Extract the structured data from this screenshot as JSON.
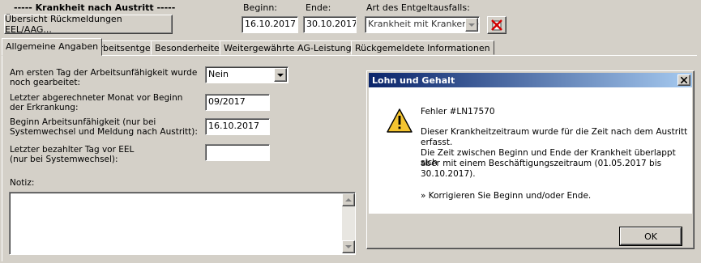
{
  "header": {
    "section_title": "----- Krankheit nach Austritt -----",
    "overview_button": "Übersicht Rückmeldungen EEL/AAG...",
    "begin_label": "Beginn:",
    "begin_value": "16.10.2017",
    "end_label": "Ende:",
    "end_value": "30.10.2017",
    "type_label": "Art des Entgeltausfalls:",
    "type_value": "Krankheit mit Krankengeld"
  },
  "tabs": [
    {
      "label": "Allgemeine Angaben",
      "active": true
    },
    {
      "label": "Arbeitsentgelt"
    },
    {
      "label": "Besonderheiten"
    },
    {
      "label": "Weitergewährte AG-Leistungen"
    },
    {
      "label": "Rückgemeldete Informationen"
    }
  ],
  "form": {
    "worked_label_1": "Am ersten Tag der Arbeitsunfähigkeit wurde",
    "worked_label_2": "noch gearbeitet:",
    "worked_value": "Nein",
    "last_month_label_1": "Letzter abgerechneter Monat vor Beginn",
    "last_month_label_2": "der Erkrankung:",
    "last_month_value": "09/2017",
    "begin_au_label_1": "Beginn Arbeitsunfähigkeit (nur bei",
    "begin_au_label_2": "Systemwechsel und Meldung nach Austritt):",
    "begin_au_value": "16.10.2017",
    "last_paid_label_1": "Letzter bezahlter Tag vor EEL",
    "last_paid_label_2": "(nur bei Systemwechsel):",
    "last_paid_value": "",
    "note_label": "Notiz:",
    "note_value": ""
  },
  "dialog": {
    "title": "Lohn und Gehalt",
    "error_code": "Fehler #LN17570",
    "line1": "Dieser Krankheitzeitraum wurde für die Zeit nach dem Austritt",
    "line2": "erfasst.",
    "line3": "Die Zeit zwischen Beginn und Ende der Krankheit überlappt sich",
    "line4": "aber mit einem Beschäftigungszeitraum (01.05.2017 bis",
    "line5": "30.10.2017).",
    "line6": "» Korrigieren Sie Beginn und/oder Ende.",
    "ok_label": "OK",
    "warning_icon": "warning-icon",
    "close_icon": "close-icon"
  },
  "colors": {
    "titlebar": "#0a246a",
    "face": "#d4d0c8",
    "warning": "#f4c430"
  }
}
